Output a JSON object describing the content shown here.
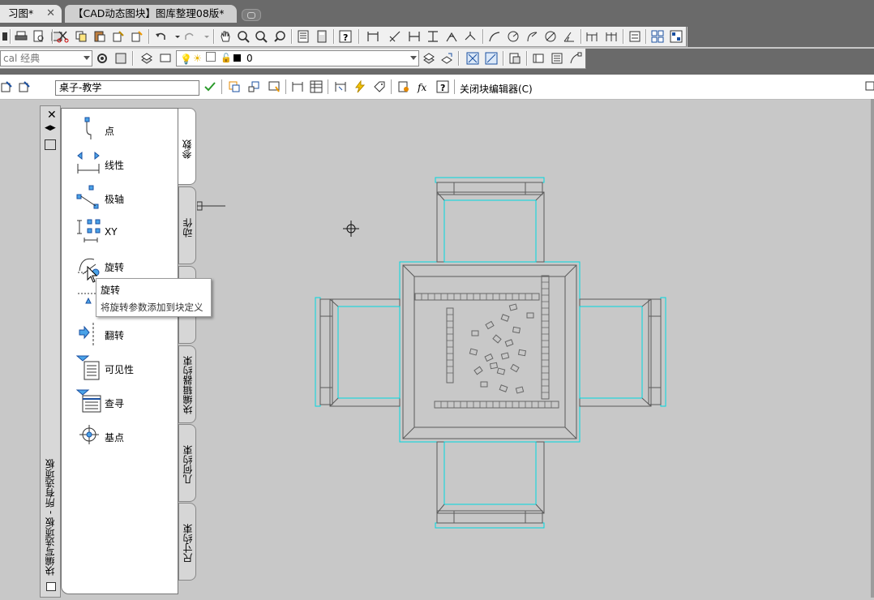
{
  "tabs": [
    {
      "label": "习图*",
      "close": "✕"
    },
    {
      "label": "【CAD动态图块】图库整理08版*"
    }
  ],
  "toolbar2": {
    "workspace_value": "cal 经典",
    "layer_value": "0"
  },
  "block_editor": {
    "block_name": "桌子-教学",
    "close_label": "关闭块编辑器(C)"
  },
  "palette": {
    "title": "块编写选项板 - 所有选项板",
    "close": "✕",
    "tools": [
      {
        "label": "点",
        "icon": "point-parameter-icon"
      },
      {
        "label": "线性",
        "icon": "linear-parameter-icon"
      },
      {
        "label": "极轴",
        "icon": "polar-parameter-icon"
      },
      {
        "label": "XY",
        "icon": "xy-parameter-icon"
      },
      {
        "label": "旋转",
        "icon": "rotation-parameter-icon"
      },
      {
        "label": "",
        "icon": "alignment-parameter-icon"
      },
      {
        "label": "翻转",
        "icon": "flip-parameter-icon"
      },
      {
        "label": "可见性",
        "icon": "visibility-parameter-icon"
      },
      {
        "label": "查寻",
        "icon": "lookup-parameter-icon"
      },
      {
        "label": "基点",
        "icon": "basepoint-parameter-icon"
      }
    ],
    "vertical_tabs": [
      "参数",
      "动作",
      "",
      "块编辑器约束",
      "几何约束",
      "尺寸约束"
    ]
  },
  "tooltip": {
    "title": "旋转",
    "description": "将旋转参数添加到块定义"
  },
  "colors": {
    "cyan_grip": "#00d8e0",
    "geometry": "#5a5a5a",
    "canvas": "#c8c8c8"
  }
}
